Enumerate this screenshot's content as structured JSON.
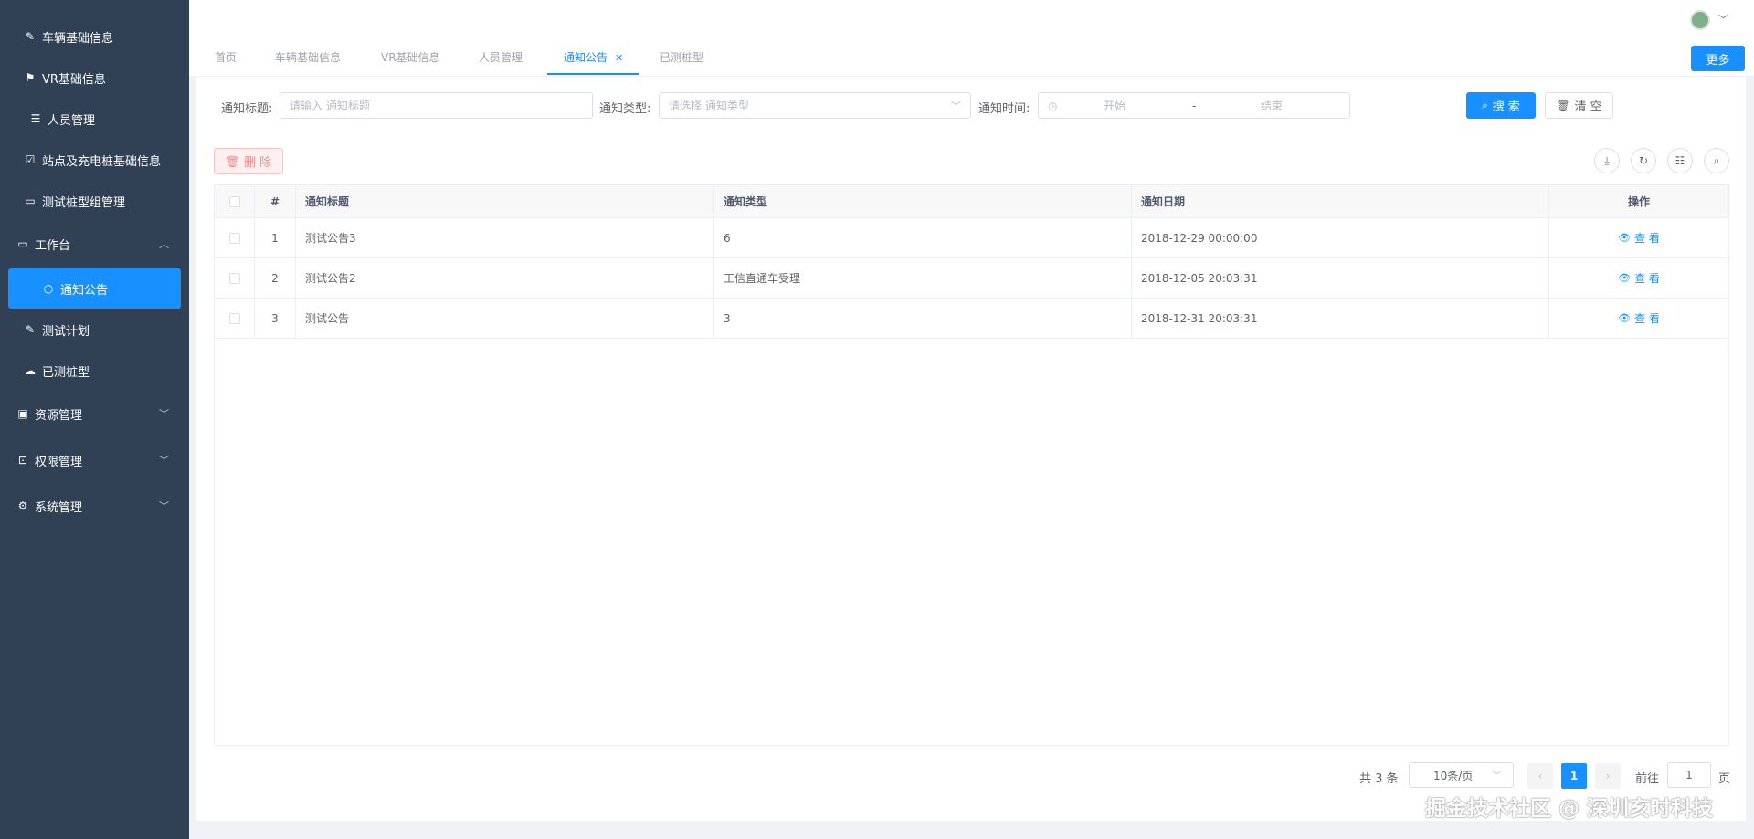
{
  "sidebar": {
    "items": [
      {
        "label": "车辆基础信息",
        "icon": "edit-icon"
      },
      {
        "label": "VR基础信息",
        "icon": "flag-icon"
      },
      {
        "label": "人员管理",
        "icon": "list-icon"
      },
      {
        "label": "站点及充电桩基础信息",
        "icon": "checkbox-icon"
      },
      {
        "label": "测试桩型组管理",
        "icon": "id-card-icon"
      },
      {
        "label": "工作台",
        "icon": "monitor-icon",
        "expanded": true
      },
      {
        "label": "通知公告",
        "icon": "circle-icon",
        "active": true
      },
      {
        "label": "测试计划",
        "icon": "edit-icon"
      },
      {
        "label": "已测桩型",
        "icon": "cloud-icon"
      },
      {
        "label": "资源管理",
        "icon": "box-icon"
      },
      {
        "label": "权限管理",
        "icon": "lock-icon"
      },
      {
        "label": "系统管理",
        "icon": "gear-icon"
      }
    ]
  },
  "tabs": [
    {
      "label": "首页"
    },
    {
      "label": "车辆基础信息"
    },
    {
      "label": "VR基础信息"
    },
    {
      "label": "人员管理"
    },
    {
      "label": "通知公告",
      "active": true
    },
    {
      "label": "已测桩型"
    }
  ],
  "more_label": "更多",
  "search": {
    "title_label": "通知标题:",
    "title_placeholder": "请输入 通知标题",
    "type_label": "通知类型:",
    "type_placeholder": "请选择 通知类型",
    "time_label": "通知时间:",
    "start_placeholder": "开始",
    "range_sep": "-",
    "end_placeholder": "结束",
    "search_btn": "搜 索",
    "clear_btn": "清 空"
  },
  "toolbar": {
    "delete_btn": "删 除"
  },
  "table": {
    "headers": {
      "index": "#",
      "title": "通知标题",
      "type": "通知类型",
      "date": "通知日期",
      "op": "操作"
    },
    "rows": [
      {
        "index": "1",
        "title": "测试公告3",
        "type": "6",
        "date": "2018-12-29 00:00:00",
        "op": "查 看"
      },
      {
        "index": "2",
        "title": "测试公告2",
        "type": "工信直通车受理",
        "date": "2018-12-05 20:03:31",
        "op": "查 看"
      },
      {
        "index": "3",
        "title": "测试公告",
        "type": "3",
        "date": "2018-12-31 20:03:31",
        "op": "查 看"
      }
    ]
  },
  "pagination": {
    "total": "共 3 条",
    "page_size": "10条/页",
    "current_page": "1",
    "goto_label": "前往",
    "goto_value": "1",
    "page_suffix": "页"
  },
  "watermark": "掘金技术社区 @ 深圳亥时科技"
}
